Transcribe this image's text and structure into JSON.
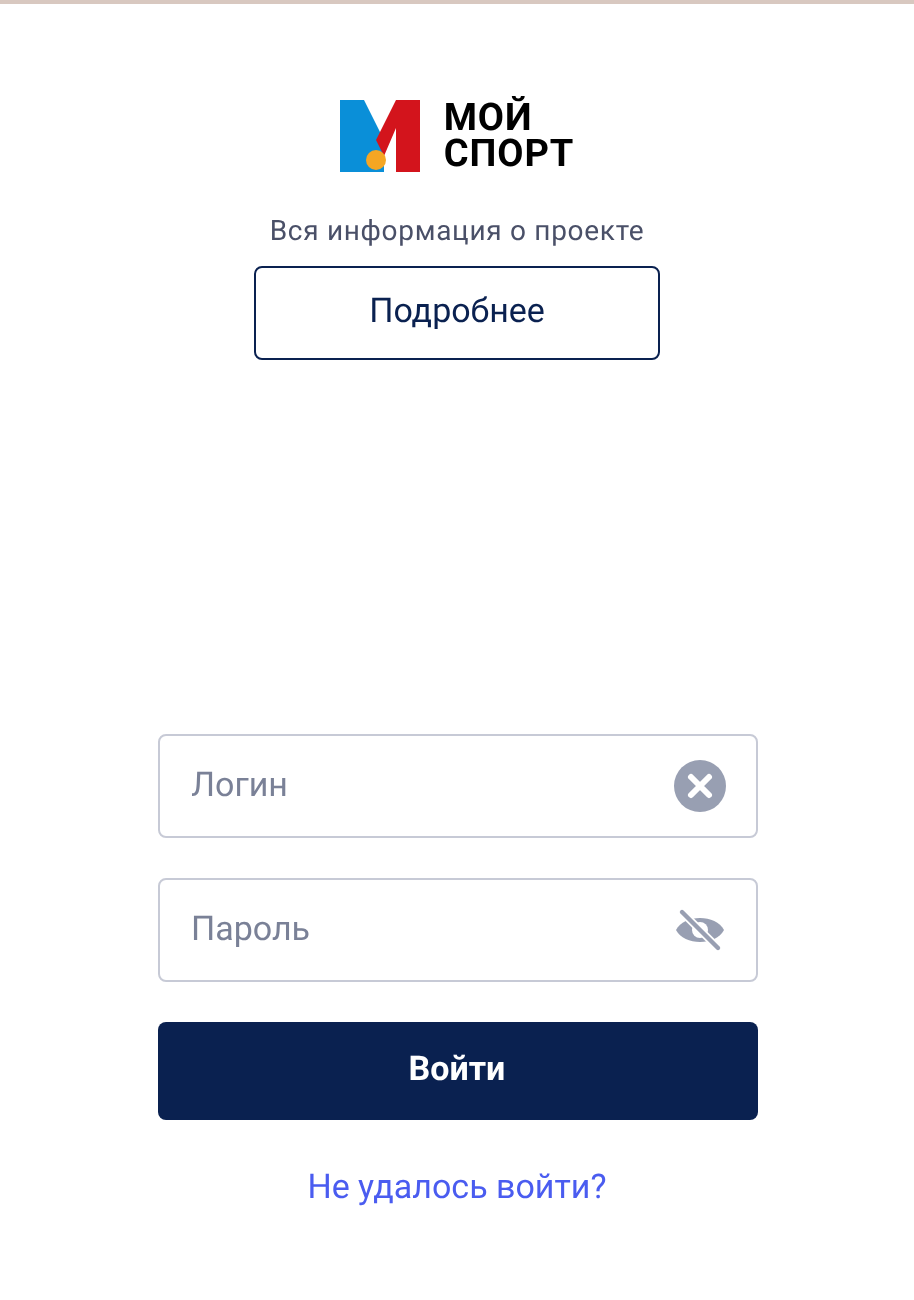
{
  "logo": {
    "lines": [
      "МОЙ",
      "СПОРТ"
    ]
  },
  "about": {
    "text": "Вся информация о проекте",
    "button": "Подробнее"
  },
  "login": {
    "placeholder": "Логин"
  },
  "password": {
    "placeholder": "Пароль"
  },
  "submit": "Войти",
  "help_link": "Не удалось войти?"
}
